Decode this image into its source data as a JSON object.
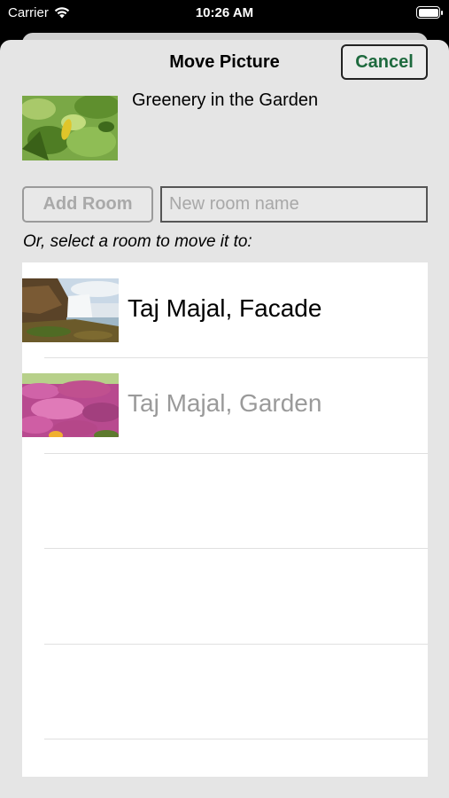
{
  "status_bar": {
    "carrier": "Carrier",
    "time": "10:26 AM"
  },
  "sheet": {
    "title": "Move Picture",
    "cancel_label": "Cancel"
  },
  "picture": {
    "name": "Greenery in the Garden"
  },
  "add_room": {
    "button_label": "Add Room",
    "input_placeholder": "New room name",
    "input_value": ""
  },
  "select_prompt": "Or, select a room to move it to:",
  "rooms": [
    {
      "label": "Taj Majal, Facade",
      "enabled": true
    },
    {
      "label": "Taj Majal, Garden",
      "enabled": false
    }
  ],
  "colors": {
    "accent": "#1e6a3e",
    "disabled_text": "#9a9a9a",
    "sheet_background": "#e5e5e5"
  }
}
